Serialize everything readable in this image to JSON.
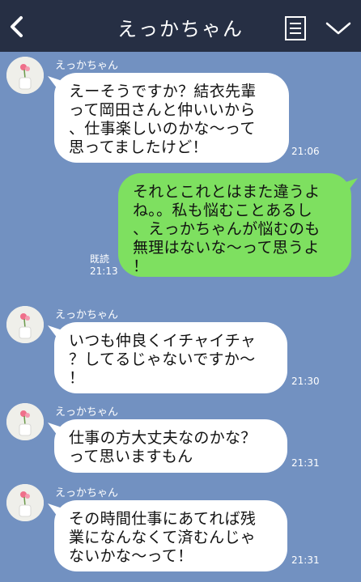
{
  "header": {
    "title": "えっかちゃん",
    "back_icon": "chevron-left-icon",
    "menu_icon": "list-icon",
    "dropdown_icon": "chevron-down-icon"
  },
  "messages": [
    {
      "direction": "incoming",
      "sender": "えっかちゃん",
      "text": "えーそうですか？結衣先輩\nって岡田さんと仲いいから\n、仕事楽しいのかな～って\n思ってましたけど！",
      "time": "21:06"
    },
    {
      "direction": "outgoing",
      "text": "それとこれとはまた違うよ\nね。。私も悩むことあるし\n、えっかちゃんが悩むのも\n無理はないな～って思うよ\n！",
      "read": "既読",
      "time": "21:13"
    },
    {
      "direction": "incoming",
      "sender": "えっかちゃん",
      "text": "いつも仲良くイチャイチャ\n？してるじゃないですか～\n！",
      "time": "21:30"
    },
    {
      "direction": "incoming",
      "sender": "えっかちゃん",
      "text": "仕事の方大丈夫なのかな？\nって思いますもん",
      "time": "21:31"
    },
    {
      "direction": "incoming",
      "sender": "えっかちゃん",
      "text": "その時間仕事にあてれば残\n業になんなくて済むんじゃ\nないかな～って！",
      "time": "21:31"
    }
  ],
  "colors": {
    "header_bg": "#262f44",
    "chat_bg": "#7291c1",
    "incoming_bubble": "#ffffff",
    "outgoing_bubble": "#7ee060"
  }
}
